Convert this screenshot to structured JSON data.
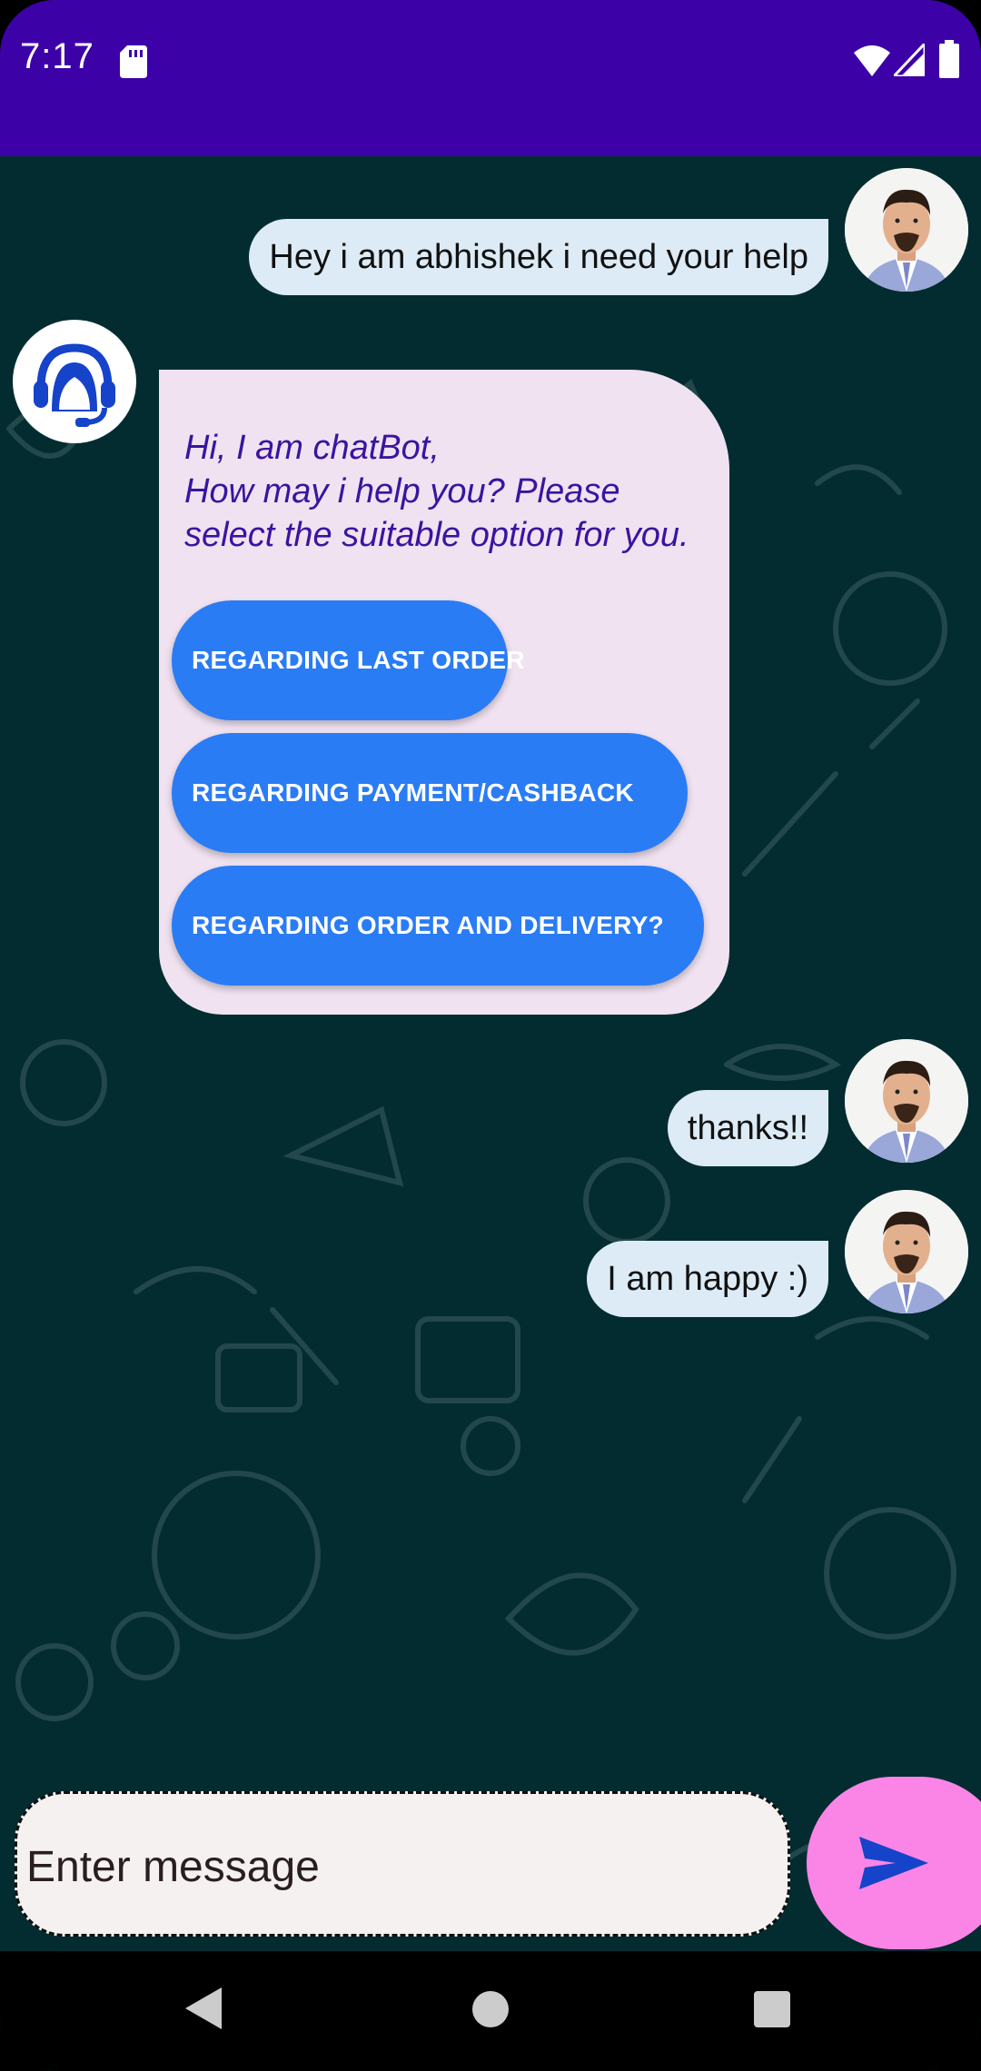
{
  "status_bar": {
    "time": "7:17",
    "background": "#3c02a8"
  },
  "messages": [
    {
      "sender": "user",
      "text": "Hey i am abhishek i need your help"
    },
    {
      "sender": "bot",
      "text": "Hi, I am chatBot,\n How may i help you? Please select the suitable option for you.",
      "options": [
        "REGARDING LAST ORDER",
        "REGARDING PAYMENT/CASHBACK",
        "REGARDING ORDER AND DELIVERY?"
      ]
    },
    {
      "sender": "user",
      "text": "thanks!!"
    },
    {
      "sender": "user",
      "text": "I am happy :)"
    }
  ],
  "composer": {
    "placeholder": "Enter message",
    "value": ""
  },
  "colors": {
    "chat_background": "#032c31",
    "user_bubble": "#dcebf5",
    "bot_bubble": "#f0e2f1",
    "bot_text": "#3a14a0",
    "option_button": "#2a7cf5",
    "send_button": "#fb85e6",
    "send_icon": "#1543c9"
  },
  "icons": {
    "bot_avatar": "headset-agent-icon",
    "user_avatar": "user-photo-avatar",
    "send": "send-icon",
    "nav_back": "back-triangle-icon",
    "nav_home": "home-circle-icon",
    "nav_recent": "recents-square-icon"
  }
}
